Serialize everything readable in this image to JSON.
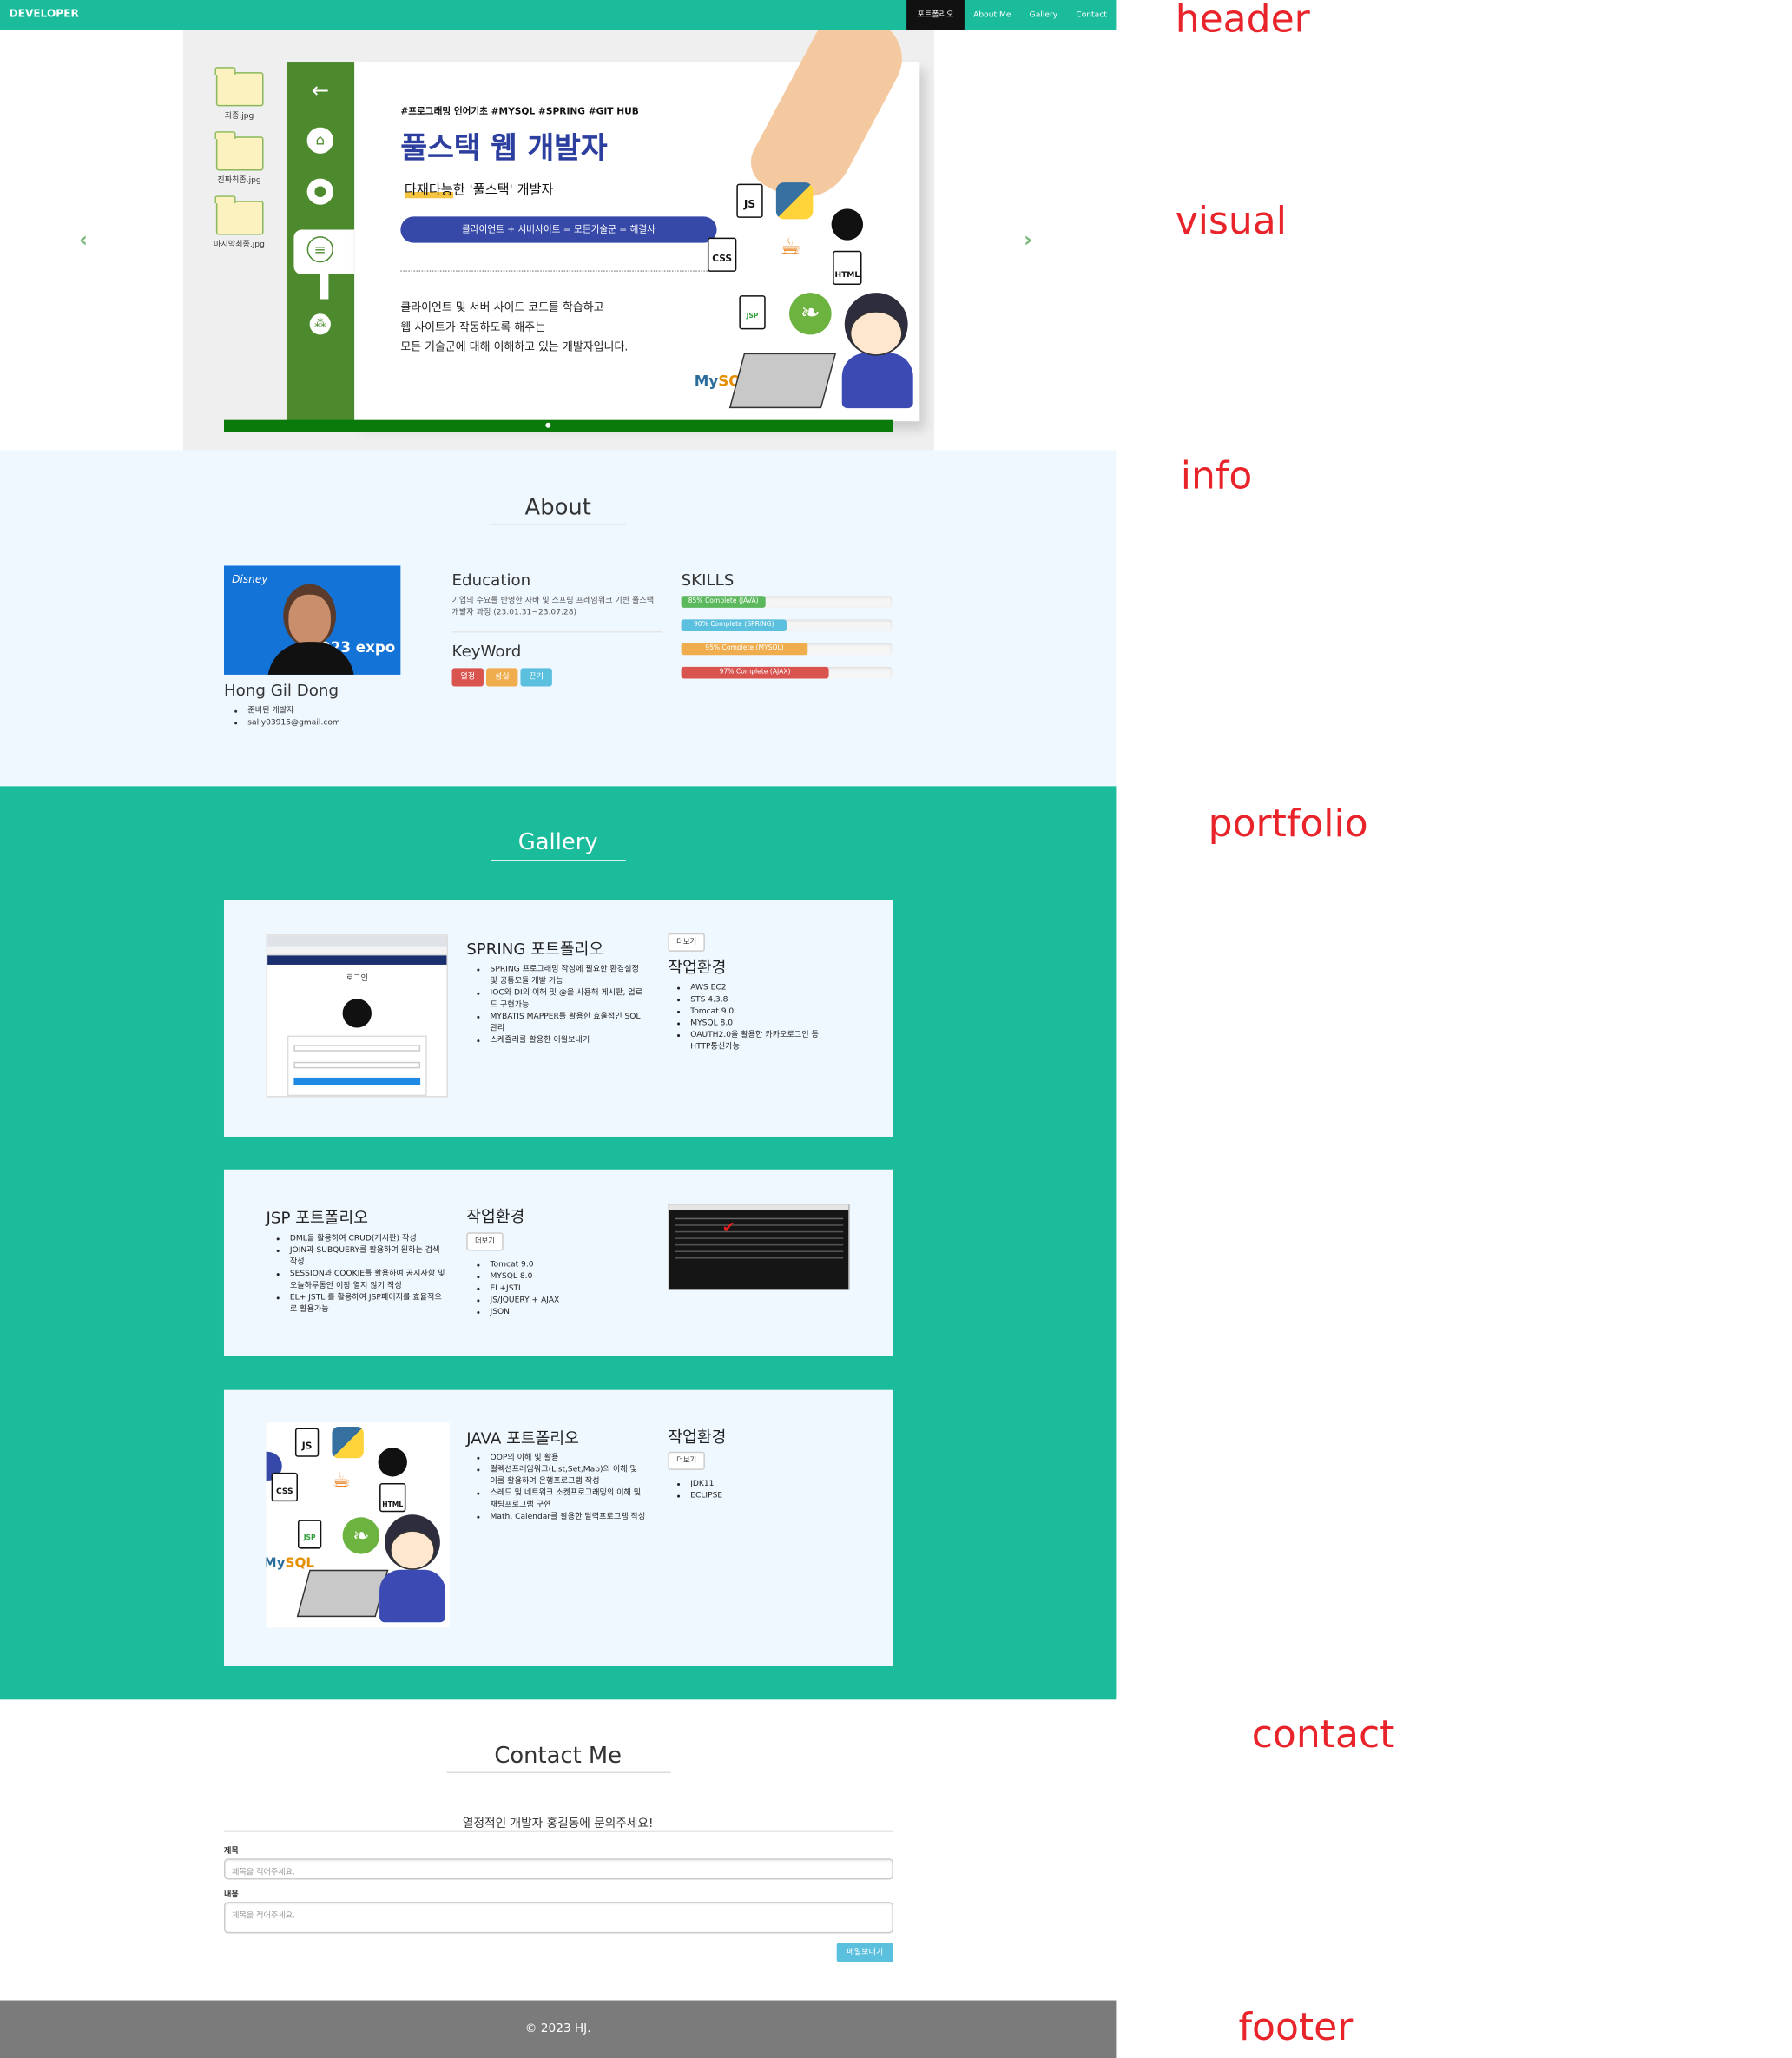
{
  "nav": {
    "brand": "DEVELOPER",
    "items": [
      "포트폴리오",
      "About Me",
      "Gallery",
      "Contact"
    ],
    "active_index": 0
  },
  "visual": {
    "folders": [
      "최종.jpg",
      "진짜최종.jpg",
      "마지막최종.jpg"
    ],
    "tags": "#프로그래밍 언어기초 #MYSQL #SPRING #GIT HUB",
    "title": "풀스택 웹 개발자",
    "subtitle_highlight": "다재다능",
    "subtitle_rest": "한 '풀스택' 개발자",
    "pill": "클라이언트 + 서버사이트 = 모든기술군 = 해결사",
    "desc": [
      "클라이언트 및 서버 사이드 코드를 학습하고",
      "웹 사이트가 작동하도록 해주는",
      "모든 기술군에 대해 이해하고 있는 개발자입니다."
    ],
    "logos": {
      "js": "JS",
      "css": "CSS",
      "html": "HTML",
      "jsp": "JSP",
      "mysql_a": "My",
      "mysql_b": "SQL"
    },
    "prev_icon": "chevron-left-icon",
    "next_icon": "chevron-right-icon"
  },
  "about": {
    "title": "About",
    "name": "Hong Gil Dong",
    "photo_text": {
      "brand": "Disney",
      "badge": "D23 expo"
    },
    "bullets": [
      "준비된 개발자",
      "sally03915@gmail.com"
    ],
    "education_title": "Education",
    "education_text": "기업의 수요를 반영한 자바 및 스프링 프레임워크 기반 풀스택 개발자 과정 (23.01.31~23.07.28)",
    "keyword_title": "KeyWord",
    "keywords": [
      "열정",
      "성실",
      "끈기"
    ],
    "keyword_colors": [
      "#d9534f",
      "#f0ad4e",
      "#5bc0de"
    ],
    "skills_title": "SKILLS",
    "skills": [
      {
        "label": "85% Complete (JAVA)",
        "value": 40,
        "color": "#5cb85c"
      },
      {
        "label": "90% Complete (SPRING)",
        "value": 50,
        "color": "#5bc0de"
      },
      {
        "label": "95% Complete (MYSQL)",
        "value": 60,
        "color": "#f0ad4e"
      },
      {
        "label": "97% Complete (AJAX)",
        "value": 70,
        "color": "#d9534f"
      }
    ]
  },
  "gallery": {
    "title": "Gallery",
    "more_label": "더보기",
    "env_title": "작업환경",
    "cards": [
      {
        "title": "SPRING 포트폴리오",
        "points": [
          "SPRING 프로그래밍 작성에 필요한 환경설정 및 공통모듈 개발 가능",
          "IOC와 DI의 이해 및 @을 사용해 게시판, 업로드 구현가능",
          "MYBATIS MAPPER를 활용한 효율적인 SQL 관리",
          "스케쥴러를 활용한 이월보내기"
        ],
        "env": [
          "AWS EC2",
          "STS 4.3.8",
          "Tomcat 9.0",
          "MYSQL 8.0",
          "OAUTH2.0을 활용한 카카오로그인 등 HTTP통신가능"
        ],
        "login_text": "로그인"
      },
      {
        "title": "JSP 포트폴리오",
        "points": [
          "DML을 활용하여 CRUD(게시판) 작성",
          "JOIN과 SUBQUERY를 활용하여 원하는 검색작성",
          "SESSION과 COOKIE를 활용하여 공지사항 및 오늘하루동안 이창 열지 않기 작성",
          "EL+ JSTL 를 활용하여 JSP페이지를 효율적으로 활용가능"
        ],
        "env": [
          "Tomcat 9.0",
          "MYSQL 8.0",
          "EL+JSTL",
          "JS/JQUERY + AJAX",
          "JSON"
        ]
      },
      {
        "title": "JAVA 포트폴리오",
        "points": [
          "OOP의 이해 및 활용",
          "컬렉션프레임워크(List,Set,Map)의 이해 및 이를 활용하여 은행프로그램 작성",
          "스레드 및 네트워크 소켓프로그래밍의 이해 및 채팅프로그램 구현",
          "Math, Calendar를 활용한 달력프로그램 작성"
        ],
        "env": [
          "JDK11",
          "ECLIPSE"
        ]
      }
    ]
  },
  "contact": {
    "title": "Contact Me",
    "lead": "열정적인 개발자 홍길동에 문의주세요!",
    "subject_label": "제목",
    "subject_placeholder": "제목을 적어주세요.",
    "content_label": "내용",
    "content_placeholder": "제목을 적어주세요.",
    "send_label": "메일보내기"
  },
  "footer": {
    "text": "© 2023 HJ."
  },
  "annotations": [
    "header",
    "visual",
    "info",
    "portfolio",
    "contact",
    "footer"
  ]
}
